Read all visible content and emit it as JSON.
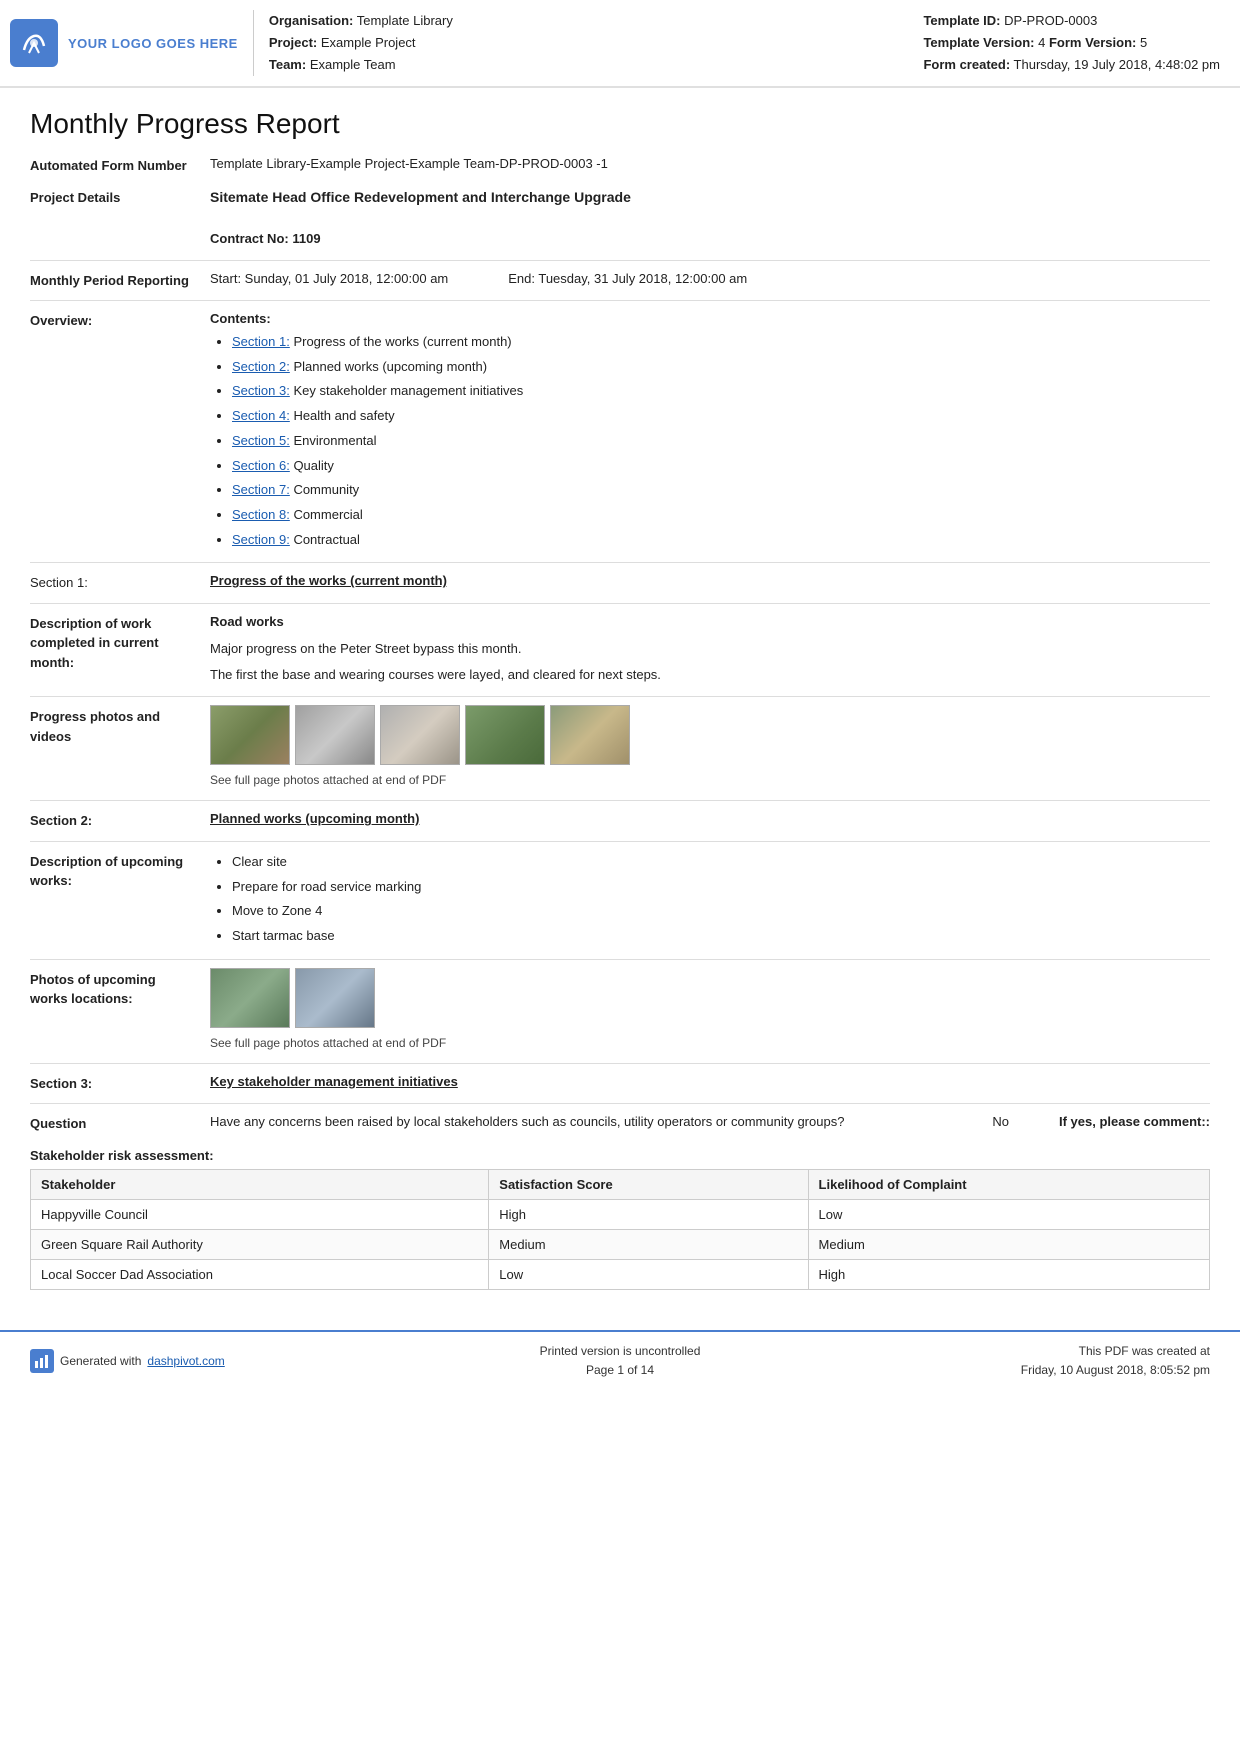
{
  "header": {
    "logo_text": "YOUR LOGO GOES HERE",
    "org_label": "Organisation:",
    "org_value": "Template Library",
    "project_label": "Project:",
    "project_value": "Example Project",
    "team_label": "Team:",
    "team_value": "Example Team",
    "template_id_label": "Template ID:",
    "template_id_value": "DP-PROD-0003",
    "template_version_label": "Template Version:",
    "template_version_value": "4",
    "form_version_label": "Form Version:",
    "form_version_value": "5",
    "form_created_label": "Form created:",
    "form_created_value": "Thursday, 19 July 2018, 4:48:02 pm"
  },
  "report": {
    "title": "Monthly Progress Report",
    "automated_form_number_label": "Automated Form Number",
    "automated_form_number_value": "Template Library-Example Project-Example Team-DP-PROD-0003   -1",
    "project_details_label": "Project Details",
    "project_details_main": "Sitemate Head Office Redevelopment and Interchange Upgrade",
    "contract_no_label": "Contract No:",
    "contract_no_value": "1109",
    "monthly_period_label": "Monthly Period Reporting",
    "period_start": "Start: Sunday, 01 July 2018, 12:00:00 am",
    "period_end": "End: Tuesday, 31 July 2018, 12:00:00 am",
    "overview_label": "Overview:",
    "contents_label": "Contents:",
    "contents": [
      {
        "link": "Section 1:",
        "text": " Progress of the works (current month)"
      },
      {
        "link": "Section 2:",
        "text": " Planned works (upcoming month)"
      },
      {
        "link": "Section 3:",
        "text": " Key stakeholder management initiatives"
      },
      {
        "link": "Section 4:",
        "text": " Health and safety"
      },
      {
        "link": "Section 5:",
        "text": " Environmental"
      },
      {
        "link": "Section 6:",
        "text": " Quality"
      },
      {
        "link": "Section 7:",
        "text": " Community"
      },
      {
        "link": "Section 8:",
        "text": " Commercial"
      },
      {
        "link": "Section 9:",
        "text": " Contractual"
      }
    ],
    "section1_label": "Section 1:",
    "section1_heading": "Progress of the works (current month)",
    "description_label": "Description of work completed in current month:",
    "road_works_heading": "Road works",
    "road_works_line1": "Major progress on the Peter Street bypass this month.",
    "road_works_line2": "The first the base and wearing courses were layed, and cleared for next steps.",
    "progress_photos_label": "Progress photos and videos",
    "photo_caption": "See full page photos attached at end of PDF",
    "section2_label": "Section 2:",
    "section2_heading": "Planned works (upcoming month)",
    "upcoming_description_label": "Description of upcoming works:",
    "upcoming_works": [
      "Clear site",
      "Prepare for road service marking",
      "Move to Zone 4",
      "Start tarmac base"
    ],
    "upcoming_photos_label": "Photos of upcoming works locations:",
    "upcoming_photo_caption": "See full page photos attached at end of PDF",
    "section3_label": "Section 3:",
    "section3_heading": "Key stakeholder management initiatives",
    "question_label": "Question",
    "question_text": "Have any concerns been raised by local stakeholders such as councils, utility operators or community groups?",
    "question_answer": "No",
    "question_comment_label": "If yes, please comment::",
    "stakeholder_section_label": "Stakeholder risk assessment:",
    "table_headers": [
      "Stakeholder",
      "Satisfaction Score",
      "Likelihood of Complaint"
    ],
    "table_rows": [
      [
        "Happyville Council",
        "High",
        "Low"
      ],
      [
        "Green Square Rail Authority",
        "Medium",
        "Medium"
      ],
      [
        "Local Soccer Dad Association",
        "Low",
        "High"
      ]
    ]
  },
  "footer": {
    "generated_text": "Generated with",
    "link_text": "dashpivot.com",
    "center_line1": "Printed version is uncontrolled",
    "center_line2": "Page 1 of 14",
    "right_line1": "This PDF was created at",
    "right_line2": "Friday, 10 August 2018, 8:05:52 pm"
  }
}
